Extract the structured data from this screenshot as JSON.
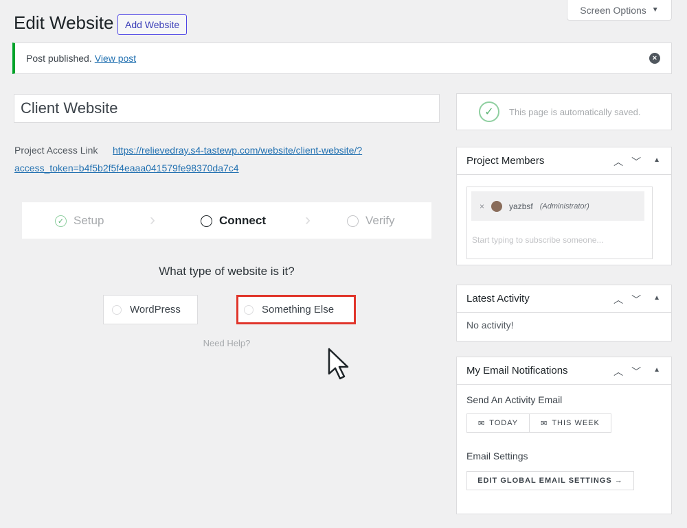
{
  "header": {
    "screen_options": "Screen Options",
    "title": "Edit Website",
    "add_new": "Add Website"
  },
  "notice": {
    "text": "Post published.",
    "link": "View post"
  },
  "post": {
    "title": "Client Website",
    "access_label": "Project Access Link",
    "access_link_line1": "https://relievedray.s4-tastewp.com/website/client-website/?",
    "access_link_line2": "access_token=b4f5b2f5f4eaaa041579fe98370da7c4"
  },
  "stepper": {
    "steps": [
      {
        "label": "Setup",
        "state": "done"
      },
      {
        "label": "Connect",
        "state": "active"
      },
      {
        "label": "Verify",
        "state": "future"
      }
    ]
  },
  "website_type": {
    "question": "What type of website is it?",
    "options": [
      "WordPress",
      "Something Else"
    ],
    "help": "Need Help?"
  },
  "sidebar": {
    "autosave": "This page is automatically saved.",
    "members": {
      "title": "Project Members",
      "member_name": "yazbsf",
      "member_role": "(Administrator)",
      "placeholder": "Start typing to subscribe someone..."
    },
    "activity": {
      "title": "Latest Activity",
      "empty": "No activity!"
    },
    "emails": {
      "title": "My Email Notifications",
      "send_label": "Send An Activity Email",
      "today": "TODAY",
      "this_week": "THIS WEEK",
      "settings_label": "Email Settings",
      "global_btn": "EDIT GLOBAL EMAIL SETTINGS →"
    }
  },
  "colors": {
    "accent": "#2271b1",
    "success": "#00a32a",
    "highlight": "#e0352b"
  }
}
